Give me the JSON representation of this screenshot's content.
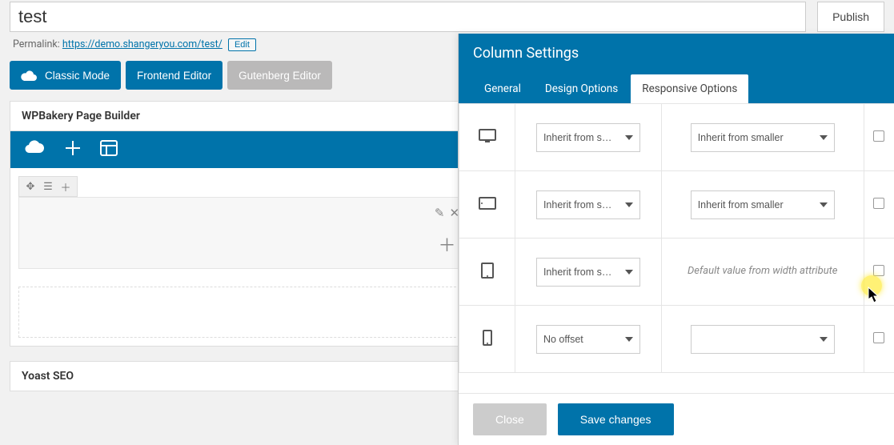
{
  "title_value": "test",
  "publish_label": "Publish",
  "permalink": {
    "label": "Permalink:",
    "url_text": "https://demo.shangeryou.com/test/",
    "edit_label": "Edit"
  },
  "mode_buttons": {
    "classic": "Classic Mode",
    "frontend": "Frontend Editor",
    "gutenberg": "Gutenberg Editor"
  },
  "builder_title": "WPBakery Page Builder",
  "yoast_title": "Yoast SEO",
  "modal": {
    "title": "Column Settings",
    "tabs": {
      "general": "General",
      "design": "Design Options",
      "responsive": "Responsive Options"
    },
    "rows": [
      {
        "offset": "Inherit from smaller",
        "width": "Inherit from smaller",
        "width_is_default": false
      },
      {
        "offset": "Inherit from smaller",
        "width": "Inherit from smaller",
        "width_is_default": false
      },
      {
        "offset": "Inherit from smaller",
        "default_text": "Default value from width attribute",
        "width_is_default": true
      },
      {
        "offset": "No offset",
        "width": "",
        "width_is_default": false
      }
    ],
    "footer": {
      "close": "Close",
      "save": "Save changes"
    }
  }
}
